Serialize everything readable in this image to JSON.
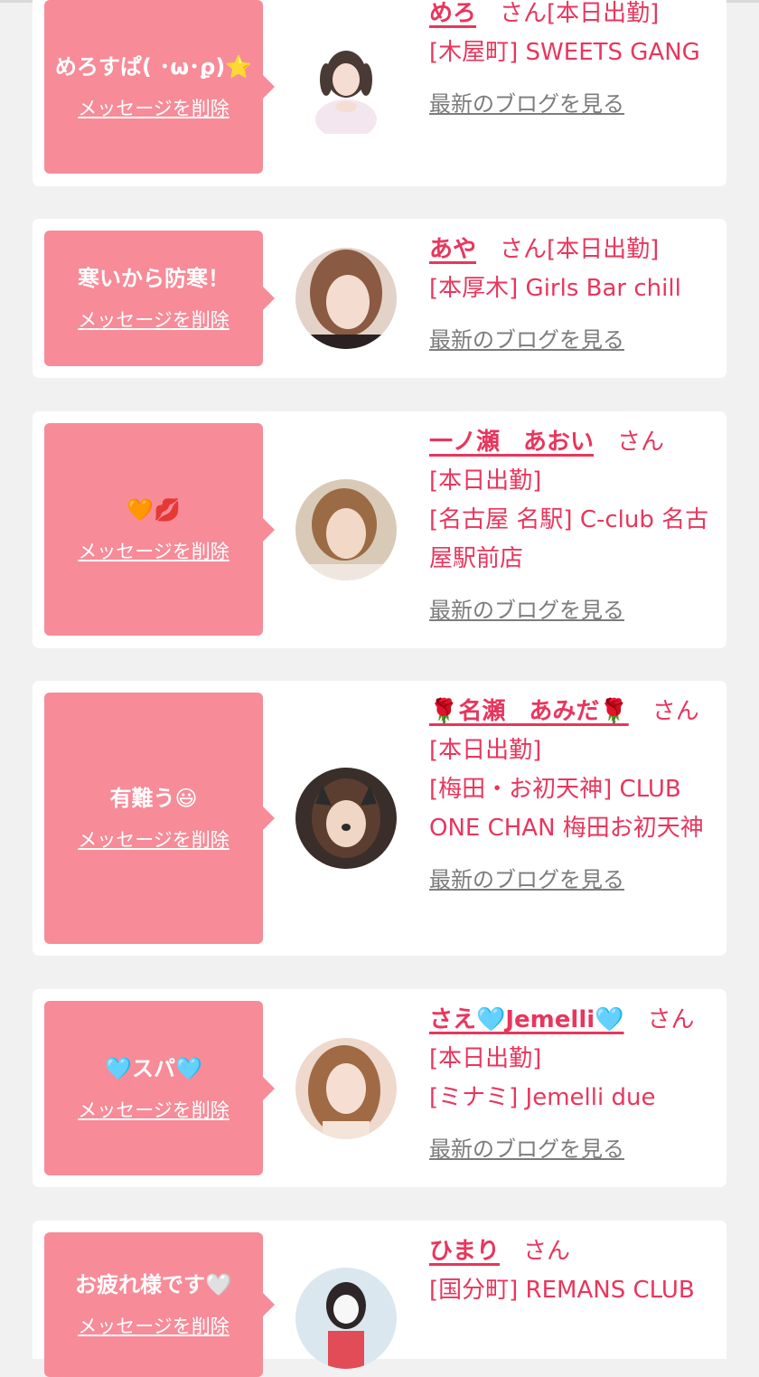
{
  "colors": {
    "accent": "#e8365d",
    "bubble": "#f78b98",
    "link_gray": "#7c7c7c",
    "background": "#f1f1f1"
  },
  "delete_label": "メッセージを削除",
  "blog_label": "最新のブログを見る",
  "honorific": "さん",
  "items": [
    {
      "message": "めろすぱ( ･ω･ϼ)⭐",
      "name": "めろ",
      "status": "[本日出勤]",
      "shop": "[木屋町] SWEETS GANG"
    },
    {
      "message": "寒いから防寒！",
      "name": "あや",
      "status": "[本日出勤]",
      "shop": "[本厚木] Girls Bar chill"
    },
    {
      "message": "🧡💋",
      "name": "一ノ瀬　あおい",
      "status": "[本日出勤]",
      "shop": "[名古屋 名駅] C-club 名古屋駅前店"
    },
    {
      "message": "有難う😃",
      "name": "🌹名瀬　あみだ🌹",
      "status": "[本日出勤]",
      "shop": "[梅田・お初天神] CLUB ONE CHAN 梅田お初天神"
    },
    {
      "message": "🩵スパ🩵",
      "name": "さえ🩵Jemelli🩵",
      "status": "[本日出勤]",
      "shop": "[ミナミ] Jemelli due"
    },
    {
      "message": "お疲れ様です🤍",
      "name": "ひまり",
      "status": "",
      "shop": "[国分町] REMANS CLUB"
    }
  ]
}
